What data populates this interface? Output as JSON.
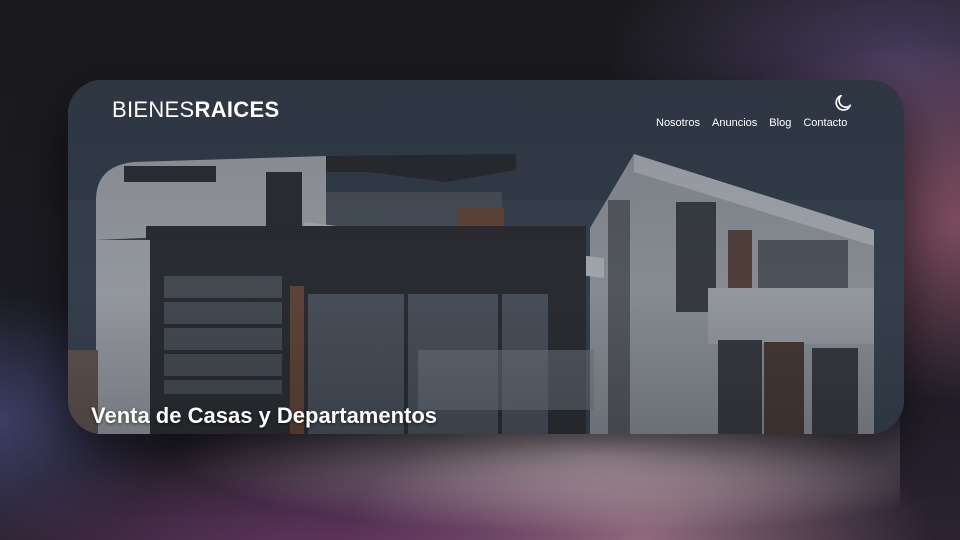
{
  "header": {
    "logo_light": "BIENES",
    "logo_bold": "RAICES",
    "theme_toggle_icon": "moon-icon"
  },
  "nav": {
    "items": [
      {
        "label": "Nosotros"
      },
      {
        "label": "Anuncios"
      },
      {
        "label": "Blog"
      },
      {
        "label": "Contacto"
      }
    ]
  },
  "hero": {
    "title": "Venta de Casas y Departamentos",
    "background_image": "modern-house-photo"
  },
  "colors": {
    "text": "#ffffff",
    "overlay": "#2b2f36"
  }
}
